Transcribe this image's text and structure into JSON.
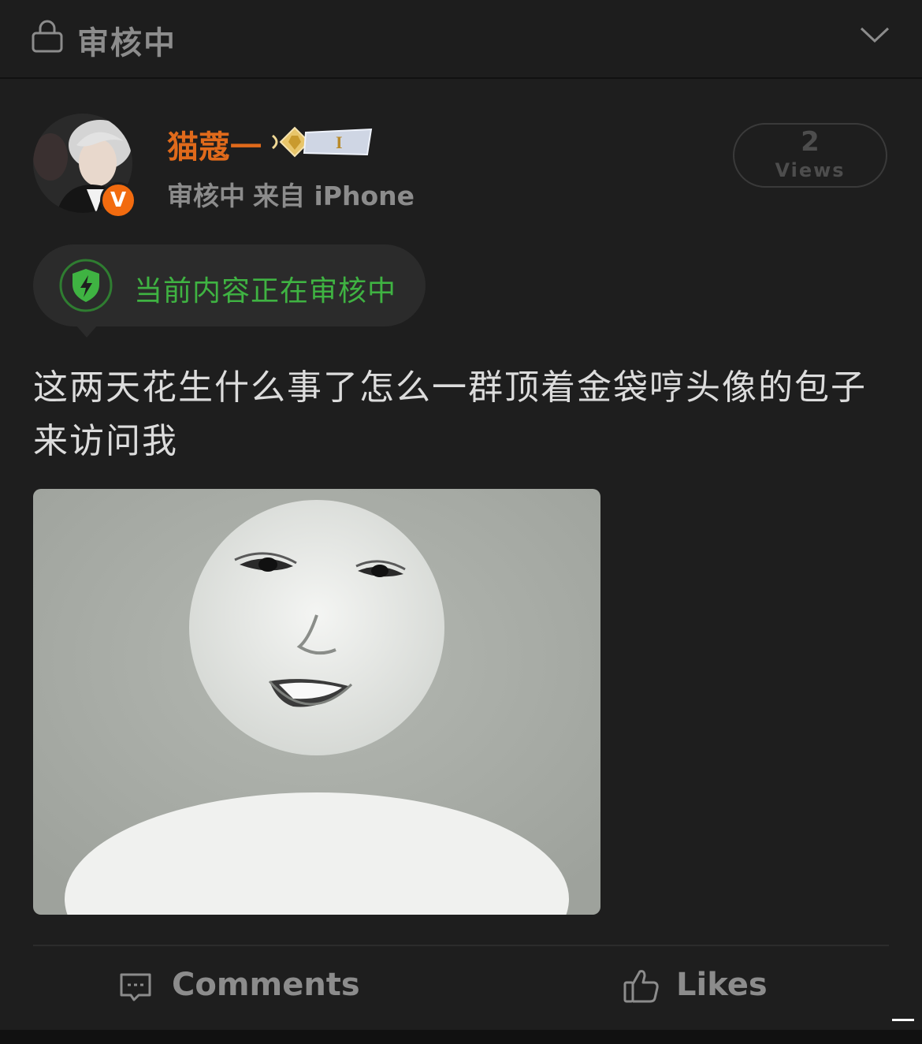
{
  "header": {
    "lock_icon": "lock-icon",
    "title": "审核中",
    "chevron_icon": "chevron-down-icon"
  },
  "post": {
    "author": {
      "name": "猫蔻一",
      "verified_badge": "V",
      "rank_badge_icon": "rank-badge-icon"
    },
    "meta": {
      "status": "审核中",
      "source": "来自 iPhone"
    },
    "views": {
      "count": "2",
      "label": "Views"
    },
    "review_notice": "当前内容正在审核中",
    "text": "这两天花生什么事了怎么一群顶着金袋哼头像的包子来访问我",
    "image_icon": "meme-face-image"
  },
  "actions": {
    "comments_label": "Comments",
    "likes_label": "Likes"
  },
  "colors": {
    "background": "#1e1e1e",
    "username": "#e06a1b",
    "verified": "#f26b0f",
    "review_green": "#3fb342",
    "muted_text": "#8c8c8c",
    "body_text": "#dcdcdc"
  }
}
